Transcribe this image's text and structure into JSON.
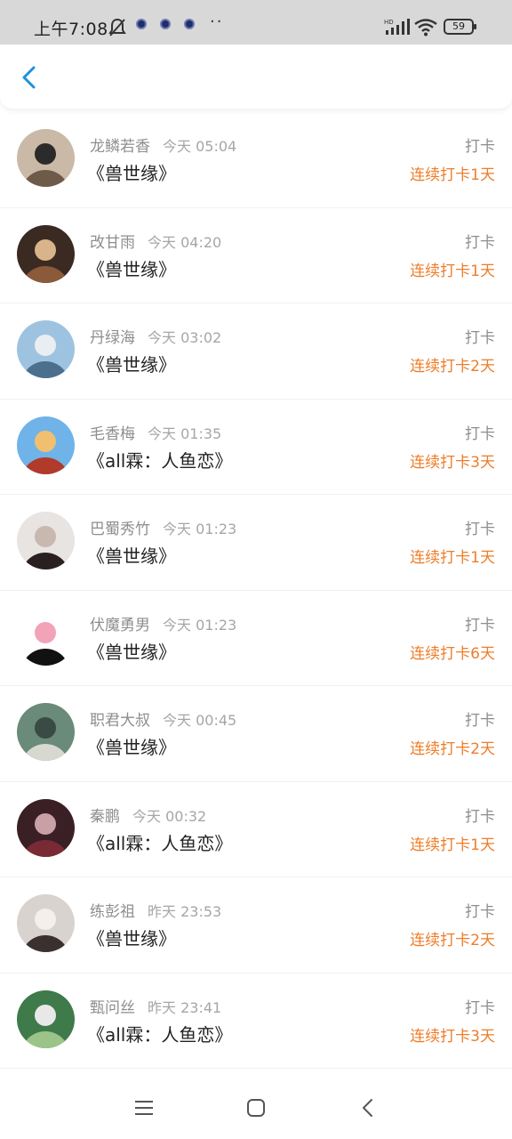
{
  "status_bar": {
    "time": "上午7:08",
    "icons": [
      "mute-bell-icon",
      "app-notification-icon",
      "app-notification-icon",
      "app-notification-icon",
      "more-dots-icon",
      "hd-signal-icon",
      "wifi-icon"
    ],
    "more": "··",
    "battery": "59"
  },
  "header": {
    "back_icon": "chevron-left-icon"
  },
  "entries": [
    {
      "name": "龙鳞若香",
      "time": "今天 05:04",
      "book": "《兽世缘》",
      "action": "打卡",
      "streak": "连续打卡1天"
    },
    {
      "name": "改甘雨",
      "time": "今天 04:20",
      "book": "《兽世缘》",
      "action": "打卡",
      "streak": "连续打卡1天"
    },
    {
      "name": "丹绿海",
      "time": "今天 03:02",
      "book": "《兽世缘》",
      "action": "打卡",
      "streak": "连续打卡2天"
    },
    {
      "name": "毛香梅",
      "time": "今天 01:35",
      "book": "《all霖：人鱼恋》",
      "action": "打卡",
      "streak": "连续打卡3天"
    },
    {
      "name": "巴蜀秀竹",
      "time": "今天 01:23",
      "book": "《兽世缘》",
      "action": "打卡",
      "streak": "连续打卡1天"
    },
    {
      "name": "伏魔勇男",
      "time": "今天 01:23",
      "book": "《兽世缘》",
      "action": "打卡",
      "streak": "连续打卡6天"
    },
    {
      "name": "职君大叔",
      "time": "今天 00:45",
      "book": "《兽世缘》",
      "action": "打卡",
      "streak": "连续打卡2天"
    },
    {
      "name": "秦鹏",
      "time": "今天 00:32",
      "book": "《all霖：人鱼恋》",
      "action": "打卡",
      "streak": "连续打卡1天"
    },
    {
      "name": "练彭祖",
      "time": "昨天 23:53",
      "book": "《兽世缘》",
      "action": "打卡",
      "streak": "连续打卡2天"
    },
    {
      "name": "甄问丝",
      "time": "昨天 23:41",
      "book": "《all霖：人鱼恋》",
      "action": "打卡",
      "streak": "连续打卡3天"
    }
  ],
  "avatar_palettes": [
    [
      "#c9b9a6",
      "#6e5a48",
      "#2b2b2b"
    ],
    [
      "#3a2a22",
      "#8a5a3a",
      "#d8b48a"
    ],
    [
      "#9ec3e0",
      "#4d6f8e",
      "#e9eef3"
    ],
    [
      "#6fb3e8",
      "#b13a2a",
      "#f0c070"
    ],
    [
      "#e8e4e2",
      "#2a2020",
      "#c8b8b0"
    ],
    [
      "#ffffff",
      "#111111",
      "#f2a3b8"
    ],
    [
      "#6a8a7a",
      "#d8d8d0",
      "#3a4a44"
    ],
    [
      "#3a1f24",
      "#7a2a34",
      "#c9a0a6"
    ],
    [
      "#d9d3cf",
      "#3b3030",
      "#f3efec"
    ],
    [
      "#3f7a4a",
      "#9cc488",
      "#e8e8e8"
    ]
  ],
  "colors": {
    "accent_orange": "#ee7d2a",
    "back_blue": "#1e90e0",
    "muted": "#8e8e8e"
  },
  "navbar": {
    "icons": [
      "menu-icon",
      "home-icon",
      "back-icon"
    ]
  }
}
